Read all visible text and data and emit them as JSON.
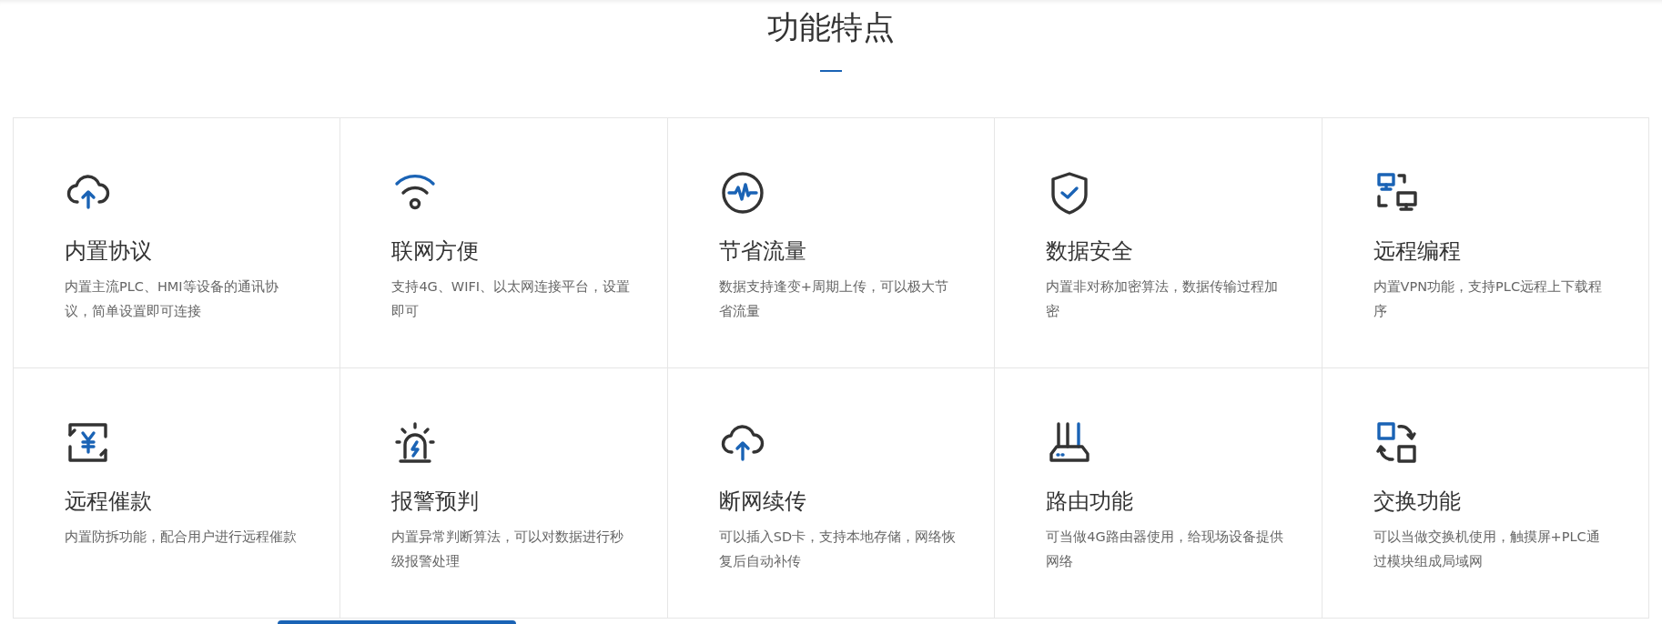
{
  "section": {
    "title": "功能特点"
  },
  "features": [
    {
      "title": "内置协议",
      "description": "内置主流PLC、HMI等设备的通讯协议，简单设置即可连接"
    },
    {
      "title": "联网方便",
      "description": "支持4G、WIFI、以太网连接平台，设置即可"
    },
    {
      "title": "节省流量",
      "description": "数据支持逢变+周期上传，可以极大节省流量"
    },
    {
      "title": "数据安全",
      "description": "内置非对称加密算法，数据传输过程加密"
    },
    {
      "title": "远程编程",
      "description": "内置VPN功能，支持PLC远程上下载程序"
    },
    {
      "title": "远程催款",
      "description": "内置防拆功能，配合用户进行远程催款"
    },
    {
      "title": "报警预判",
      "description": "内置异常判断算法，可以对数据进行秒级报警处理"
    },
    {
      "title": "断网续传",
      "description": "可以插入SD卡，支持本地存储，网络恢复后自动补传"
    },
    {
      "title": "路由功能",
      "description": "可当做4G路由器使用，给现场设备提供网络"
    },
    {
      "title": "交换功能",
      "description": "可以当做交换机使用，触摸屏+PLC通过模块组成局域网"
    }
  ]
}
